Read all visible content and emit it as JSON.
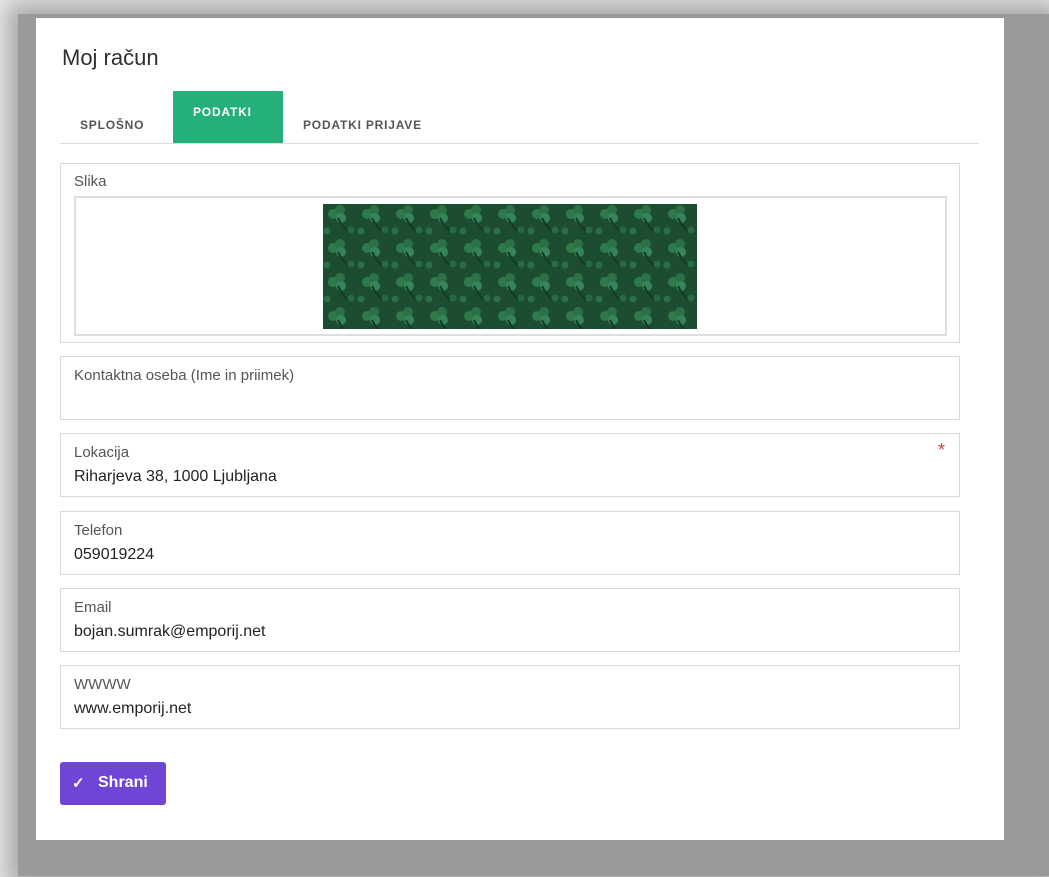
{
  "page": {
    "title": "Moj račun"
  },
  "tabs": [
    {
      "label": "SPLOŠNO",
      "active": false
    },
    {
      "label": "PODATKI",
      "active": true
    },
    {
      "label": "PODATKI PRIJAVE",
      "active": false
    }
  ],
  "form": {
    "image": {
      "label": "Slika"
    },
    "contact": {
      "label": "Kontaktna oseba (Ime in priimek)",
      "value": ""
    },
    "location": {
      "label": "Lokacija",
      "value": "Riharjeva 38, 1000 Ljubljana",
      "required_mark": "*"
    },
    "phone": {
      "label": "Telefon",
      "value": "059019224"
    },
    "email": {
      "label": "Email",
      "value": "bojan.sumrak@emporij.net"
    },
    "web": {
      "label": "WWWW",
      "value": "www.emporij.net"
    }
  },
  "actions": {
    "save_label": "Shrani",
    "save_icon": "checkmark-icon"
  },
  "colors": {
    "tab_active": "#25b07a",
    "save_button": "#6f45d6",
    "required": "#d43b3b",
    "image_pattern": "#1f5a37"
  }
}
